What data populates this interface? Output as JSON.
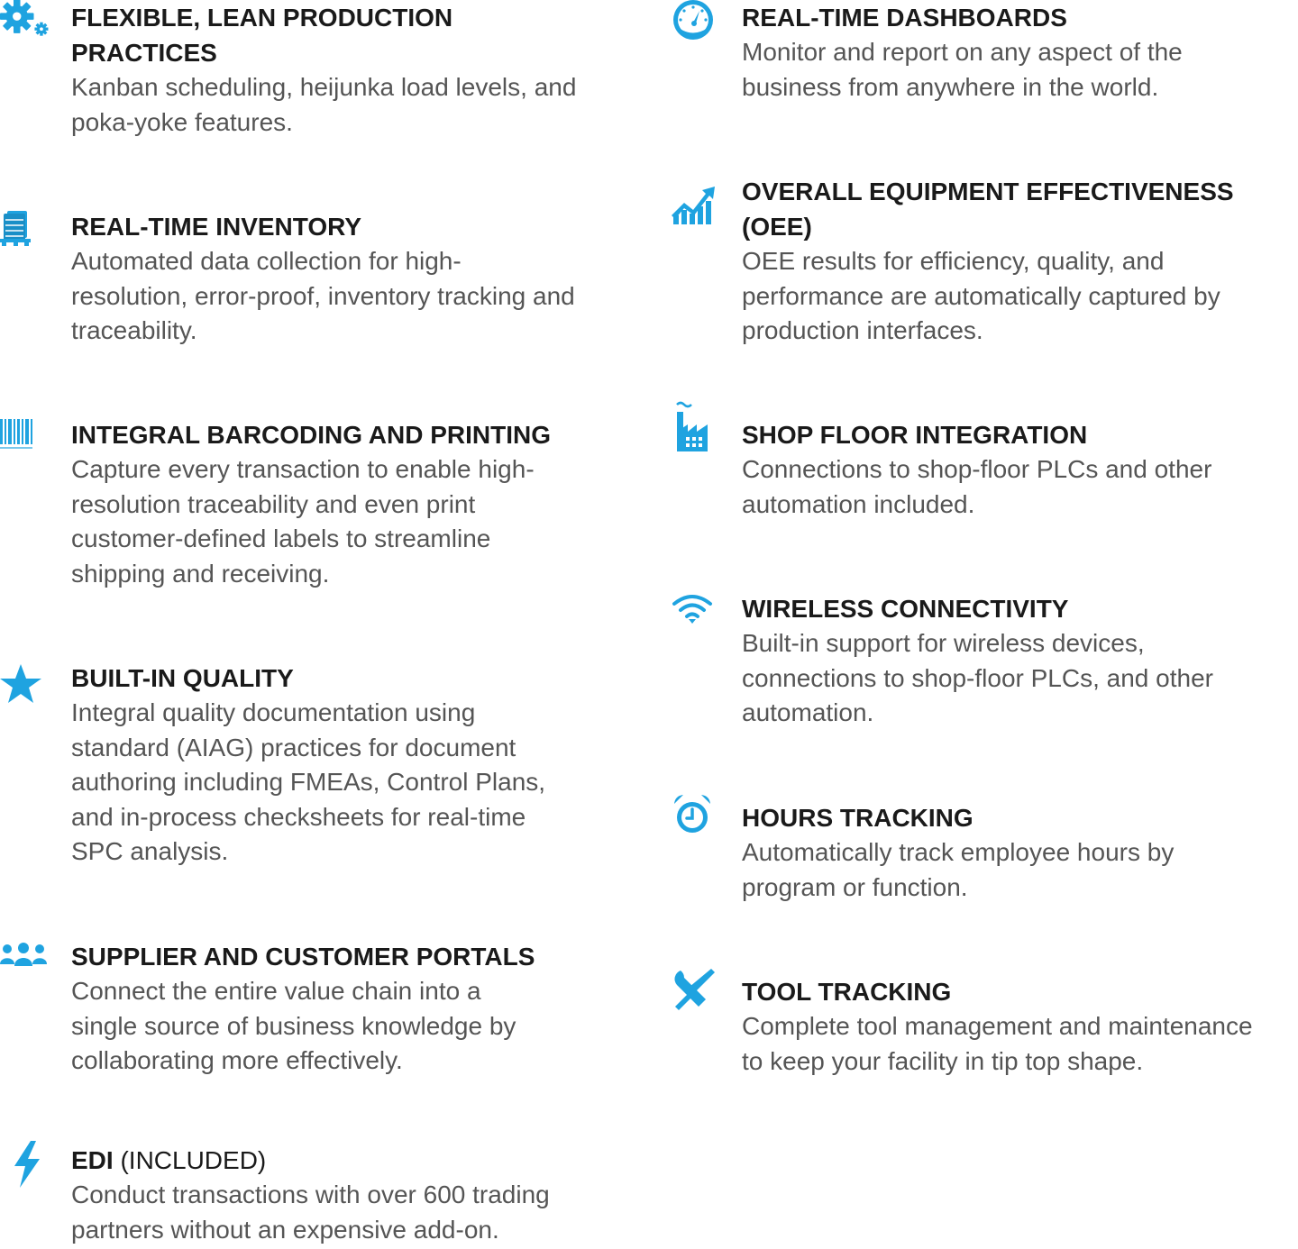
{
  "accent_color": "#1fa3e0",
  "left_features": [
    {
      "icon": "gears-icon",
      "title": "FLEXIBLE, LEAN PRODUCTION\nPRACTICES",
      "suffix": "",
      "description": "Kanban scheduling, heijunka load levels, and\npoka-yoke features."
    },
    {
      "icon": "inventory-pallet-icon",
      "title": "REAL-TIME INVENTORY",
      "suffix": "",
      "description": "Automated data collection for high-\nresolution, error-proof, inventory tracking and\ntraceability."
    },
    {
      "icon": "barcode-icon",
      "title": "INTEGRAL BARCODING AND PRINTING",
      "suffix": "",
      "description": "Capture every transaction to enable high-\nresolution traceability and even print\ncustomer-defined labels to streamline\nshipping and receiving."
    },
    {
      "icon": "star-icon",
      "title": "BUILT-IN QUALITY",
      "suffix": "",
      "description": "Integral quality documentation using\nstandard (AIAG) practices for document\nauthoring including FMEAs, Control Plans,\nand in-process checksheets for real-time\nSPC analysis."
    },
    {
      "icon": "people-icon",
      "title": "SUPPLIER AND CUSTOMER PORTALS",
      "suffix": "",
      "description": "Connect the entire value chain into a\nsingle source of business knowledge by\ncollaborating more effectively."
    },
    {
      "icon": "lightning-icon",
      "title": "EDI",
      "suffix": " (INCLUDED)",
      "description": "Conduct transactions with over 600 trading\npartners without an expensive add-on."
    }
  ],
  "right_features": [
    {
      "icon": "gauge-icon",
      "title": "REAL-TIME DASHBOARDS",
      "suffix": "",
      "description": "Monitor and report on any aspect of the\nbusiness from anywhere in the world."
    },
    {
      "icon": "trend-chart-icon",
      "title": "OVERALL EQUIPMENT EFFECTIVENESS\n(OEE)",
      "suffix": "",
      "description": "OEE results for efficiency, quality, and\nperformance are automatically captured by\nproduction interfaces."
    },
    {
      "icon": "factory-icon",
      "title": "SHOP FLOOR INTEGRATION",
      "suffix": "",
      "description": "Connections to shop-floor PLCs and other\nautomation included."
    },
    {
      "icon": "wifi-icon",
      "title": "WIRELESS CONNECTIVITY",
      "suffix": "",
      "description": "Built-in support for wireless devices,\nconnections to shop-floor PLCs, and other\nautomation."
    },
    {
      "icon": "alarm-clock-icon",
      "title": "HOURS TRACKING",
      "suffix": "",
      "description": "Automatically track employee hours by\nprogram or function."
    },
    {
      "icon": "tools-icon",
      "title": "TOOL TRACKING",
      "suffix": "",
      "description": "Complete tool management and maintenance\nto keep your facility in tip top shape."
    }
  ]
}
